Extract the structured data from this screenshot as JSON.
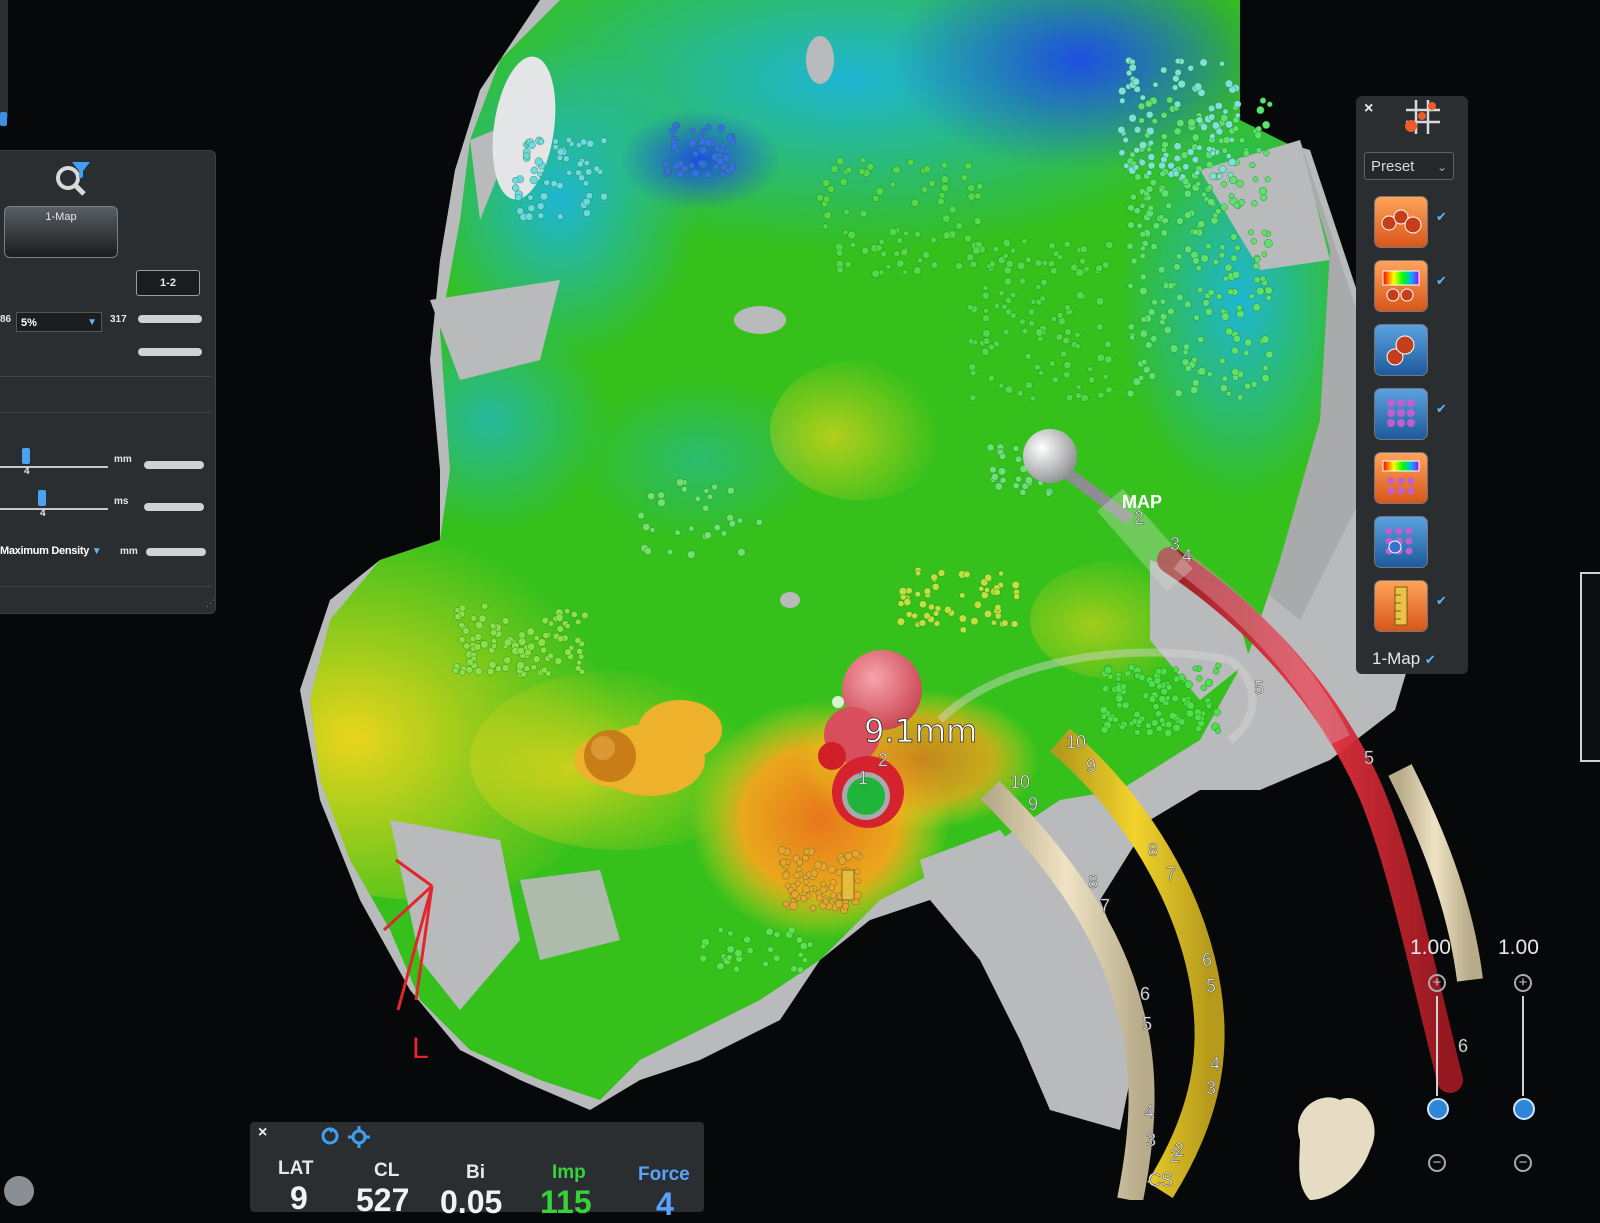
{
  "map": {
    "measurement": "9.1mm",
    "map_label": "MAP",
    "orientation_letter": "L",
    "map_electrode_numbers": [
      "2",
      "3",
      "4",
      "5"
    ],
    "catheter_a_numbers": [
      "10",
      "9",
      "8",
      "7",
      "6",
      "5",
      "4",
      "3",
      "2"
    ],
    "catheter_b_numbers": [
      "10",
      "9",
      "8",
      "7",
      "6",
      "5",
      "4",
      "3",
      "2",
      "CS"
    ],
    "ablation_numbers": [
      "1",
      "2"
    ],
    "red_catheter_numbers": [
      "5",
      "6"
    ],
    "colors": {
      "green": "#33c21b",
      "yellow": "#e6d21a",
      "cyan": "#1fb6d4",
      "blue": "#1d4fe0",
      "red": "#e0262e",
      "orange": "#e07a1a",
      "gray": "#b8b9bb"
    }
  },
  "left_panel": {
    "button_map": "1-Map",
    "button_map12": "1-2",
    "range_min": "86",
    "percent_select": "5%",
    "range_max": "317",
    "slider1_value": "4",
    "slider1_unit": "mm",
    "slider2_value": "4",
    "slider2_unit": "ms",
    "density_select": "Maximum Density",
    "density_unit": "mm",
    "filter_icon": "filter-search-icon"
  },
  "right_toolbar": {
    "close": "×",
    "preset_label": "Preset",
    "map_select": "1-Map",
    "tools": [
      "points-tool",
      "color-bar-tool",
      "point-pair-tool",
      "grid-points-tool",
      "grid-color-tool",
      "grid-blue-tool",
      "ruler-tool"
    ]
  },
  "zoom": {
    "left_value": "1.00",
    "right_value": "1.00"
  },
  "readout": {
    "close": "×",
    "labels": {
      "lat": "LAT",
      "cl": "CL",
      "bi": "Bi",
      "imp": "Imp",
      "force": "Force"
    },
    "values": {
      "lat": "9",
      "cl": "527",
      "bi": "0.05",
      "imp": "115",
      "force": "4"
    },
    "colors": {
      "imp": "#36d23a",
      "force": "#5aa2ff"
    }
  }
}
